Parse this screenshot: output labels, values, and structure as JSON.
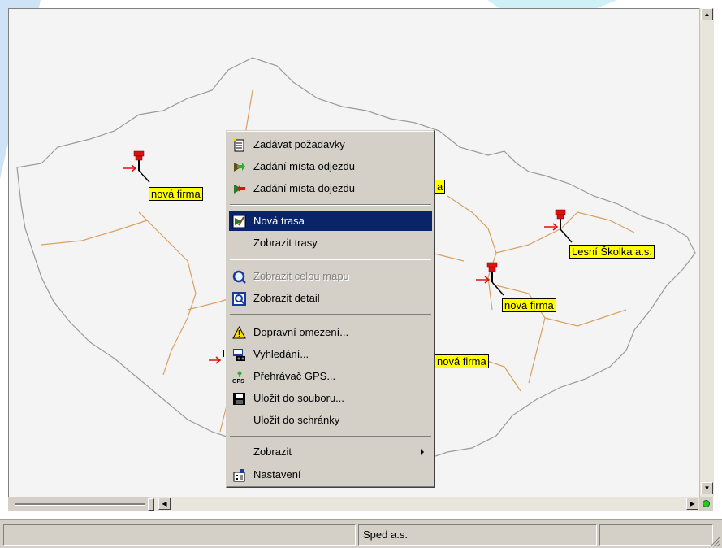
{
  "context_menu": {
    "items": [
      {
        "label": "Zadávat požadavky",
        "icon": "document-icon"
      },
      {
        "label": "Zadání místa odjezdu",
        "icon": "green-arrow-out-icon"
      },
      {
        "label": "Zadání místa dojezdu",
        "icon": "red-arrow-in-icon"
      },
      {
        "label": "Nová trasa",
        "icon": "new-route-icon",
        "selected": true
      },
      {
        "label": "Zobrazit trasy"
      },
      {
        "label": "Zobrazit celou mapu",
        "icon": "magnifier-icon",
        "disabled": true
      },
      {
        "label": "Zobrazit detail",
        "icon": "magnifier-detail-icon"
      },
      {
        "label": "Dopravní omezení...",
        "icon": "warning-icon"
      },
      {
        "label": "Vyhledání...",
        "icon": "search-binoculars-icon"
      },
      {
        "label": "Přehrávač GPS...",
        "icon": "gps-icon"
      },
      {
        "label": "Uložit do souboru...",
        "icon": "floppy-disk-icon"
      },
      {
        "label": "Uložit do schránky"
      },
      {
        "label": "Zobrazit",
        "submenu": true
      },
      {
        "label": "Nastavení",
        "icon": "settings-icon"
      }
    ]
  },
  "map": {
    "markers": [
      {
        "label": "nová firma"
      },
      {
        "label": "Lesní Školka a.s."
      },
      {
        "label": "nová firma"
      },
      {
        "label": "nová firma"
      },
      {
        "label": "a"
      }
    ]
  },
  "statusbar": {
    "company": "Sped a.s."
  },
  "colors": {
    "menu_bg": "#d4d0c8",
    "selection": "#0a246a",
    "label_bg": "#ffff00",
    "pin": "#e01010",
    "border_country": "#9a9a9a",
    "border_region": "#d9a060"
  }
}
